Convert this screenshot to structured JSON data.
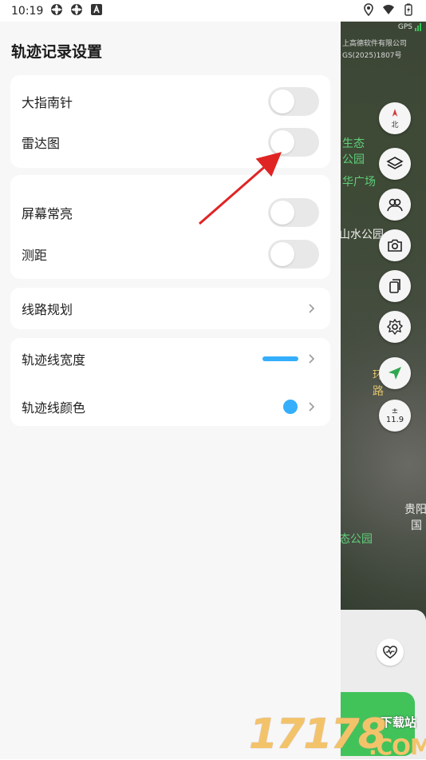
{
  "status_bar": {
    "time": "10:19",
    "left_icons": [
      "tracking-icon",
      "tracking-icon",
      "a-icon"
    ],
    "right_icons": [
      "location-icon",
      "wifi-icon",
      "battery-icon"
    ]
  },
  "panel": {
    "title": "轨迹记录设置",
    "groups": [
      {
        "items": [
          {
            "label": "大指南针",
            "control": "toggle",
            "on": false
          },
          {
            "label": "雷达图",
            "control": "toggle",
            "on": false
          }
        ]
      },
      {
        "items": [
          {
            "label": "屏幕常亮",
            "control": "toggle",
            "on": false
          },
          {
            "label": "测距",
            "control": "toggle",
            "on": false
          }
        ]
      },
      {
        "items": [
          {
            "label": "线路规划",
            "control": "chevron"
          }
        ]
      },
      {
        "items": [
          {
            "label": "轨迹线宽度",
            "control": "width-bar"
          },
          {
            "label": "轨迹线颜色",
            "control": "color-dot"
          }
        ]
      }
    ],
    "accent_color": "#35aefc"
  },
  "map": {
    "gps_label": "GPS",
    "copyright_line1": "上高德软件有限公司",
    "copyright_line2": "GS(2025)1807号",
    "places": [
      "生态",
      "公园",
      "华广场",
      "山水公园",
      "环",
      "路",
      "贵阳",
      "国",
      "态公园"
    ],
    "buttons": {
      "north_label": "北",
      "zoom_sign": "±",
      "zoom_level": "11.9"
    }
  },
  "watermark": {
    "digits": "17178",
    "site_label": "下载站",
    "domain_suffix": ".COM"
  }
}
